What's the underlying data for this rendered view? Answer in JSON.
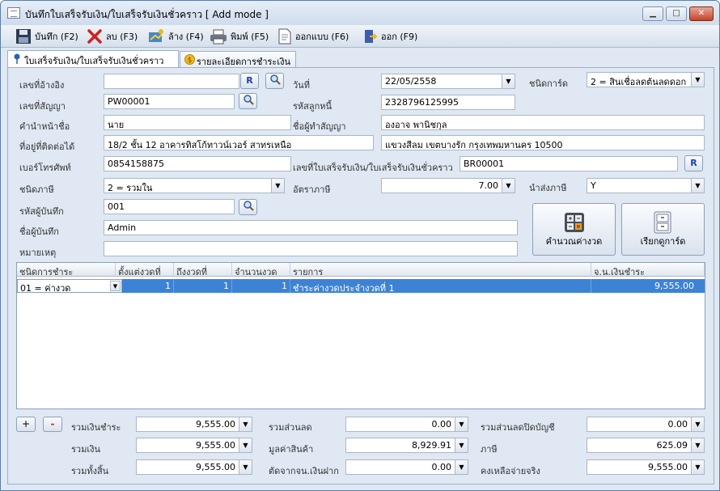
{
  "window": {
    "title": "บันทึกใบเสร็จรับเงิน/ใบเสร็จรับเงินชั่วคราว [ Add mode ]",
    "min": "▁",
    "max": "□",
    "close": "✕"
  },
  "toolbar": {
    "save": "บันทึก (F2)",
    "delete": "ลบ (F3)",
    "clear": "ล้าง (F4)",
    "print": "พิมพ์ (F5)",
    "design": "ออกแบบ (F6)",
    "exit": "ออก (F9)"
  },
  "tabs": [
    {
      "label": "ใบเสร็จรับเงิน/ใบเสร็จรับเงินชั่วคราว"
    },
    {
      "label": "รายละเอียดการชำระเงิน"
    }
  ],
  "form": {
    "ref_label": "เลขที่อ้างอิง",
    "ref_value": "",
    "r_button": "R",
    "date_label": "วันที่",
    "date_value": "22/05/2558",
    "card_type_label": "ชนิดการ์ด",
    "card_type_value": "2 = สินเชื่อลดต้นลดดอก",
    "contract_label": "เลขที่สัญญา",
    "contract_value": "PW00001",
    "debtor_code_label": "รหัสลูกหนี้",
    "debtor_code_value": "2328796125995",
    "prefix_label": "คำนำหน้าชื่อ",
    "prefix_value": "นาย",
    "contractor_label": "ชื่อผู้ทำสัญญา",
    "contractor_value": "องอาจ พานิชกุล",
    "address_label": "ที่อยู่ที่ติดต่อได้",
    "address1": "18/2  ชั้น 12  อาคารทิสโก้ทาวน์เวอร์ สาทรเหนือ",
    "address2": "แขวงสีลม เขตบางรัก กรุงเทพมหานคร 10500",
    "phone_label": "เบอร์โทรศัพท์",
    "phone_value": "0854158875",
    "receipt_no_label": "เลขที่ใบเสร็จรับเงิน/ใบเสร็จรับเงินชั่วคราว",
    "receipt_no_value": "BR00001",
    "tax_type_label": "ชนิดภาษี",
    "tax_type_value": "2 = รวมใน",
    "tax_rate_label": "อัตราภาษี",
    "tax_rate_value": "7.00",
    "submit_tax_label": "นำส่งภาษี",
    "submit_tax_value": "Y",
    "recorder_code_label": "รหัสผู้บันทึก",
    "recorder_code_value": "001",
    "recorder_name_label": "ชื่อผู้บันทึก",
    "recorder_name_value": "Admin",
    "note_label": "หมายเหตุ",
    "note_value": ""
  },
  "big_buttons": {
    "calc": "คำนวณค่างวด",
    "call_card": "เรียกดูการ์ด"
  },
  "grid": {
    "headers": [
      "ชนิดการชำระ",
      "ตั้งแต่งวดที่",
      "ถึงงวดที่",
      "จำนวนงวด",
      "รายการ",
      "จ.น.เงินชำระ"
    ],
    "rows": [
      {
        "type": "01 = ค่างวด",
        "from": "1",
        "to": "1",
        "count": "1",
        "desc": "ชำระค่างวดประจำงวดที่  1",
        "amount": "9,555.00"
      }
    ]
  },
  "totals": {
    "plus": "+",
    "minus": "-",
    "total_pay_label": "รวมเงินชำระ",
    "total_pay": "9,555.00",
    "total_discount_label": "รวมส่วนลด",
    "total_discount": "0.00",
    "total_close_discount_label": "รวมส่วนลดปิดบัญชี",
    "total_close_discount": "0.00",
    "total_money_label": "รวมเงิน",
    "total_money": "9,555.00",
    "goods_value_label": "มูลค่าสินค้า",
    "goods_value": "8,929.91",
    "tax_label": "ภาษี",
    "tax": "625.09",
    "grand_total_label": "รวมทั้งสิ้น",
    "grand_total": "9,555.00",
    "deposit_label": "ตัดจากจน.เงินฝาก",
    "deposit": "0.00",
    "remain_label": "คงเหลือจ่ายจริง",
    "remain": "9,555.00"
  },
  "colors": {
    "accent": "#3c83d6",
    "window_bg": "#dfe8f3"
  }
}
